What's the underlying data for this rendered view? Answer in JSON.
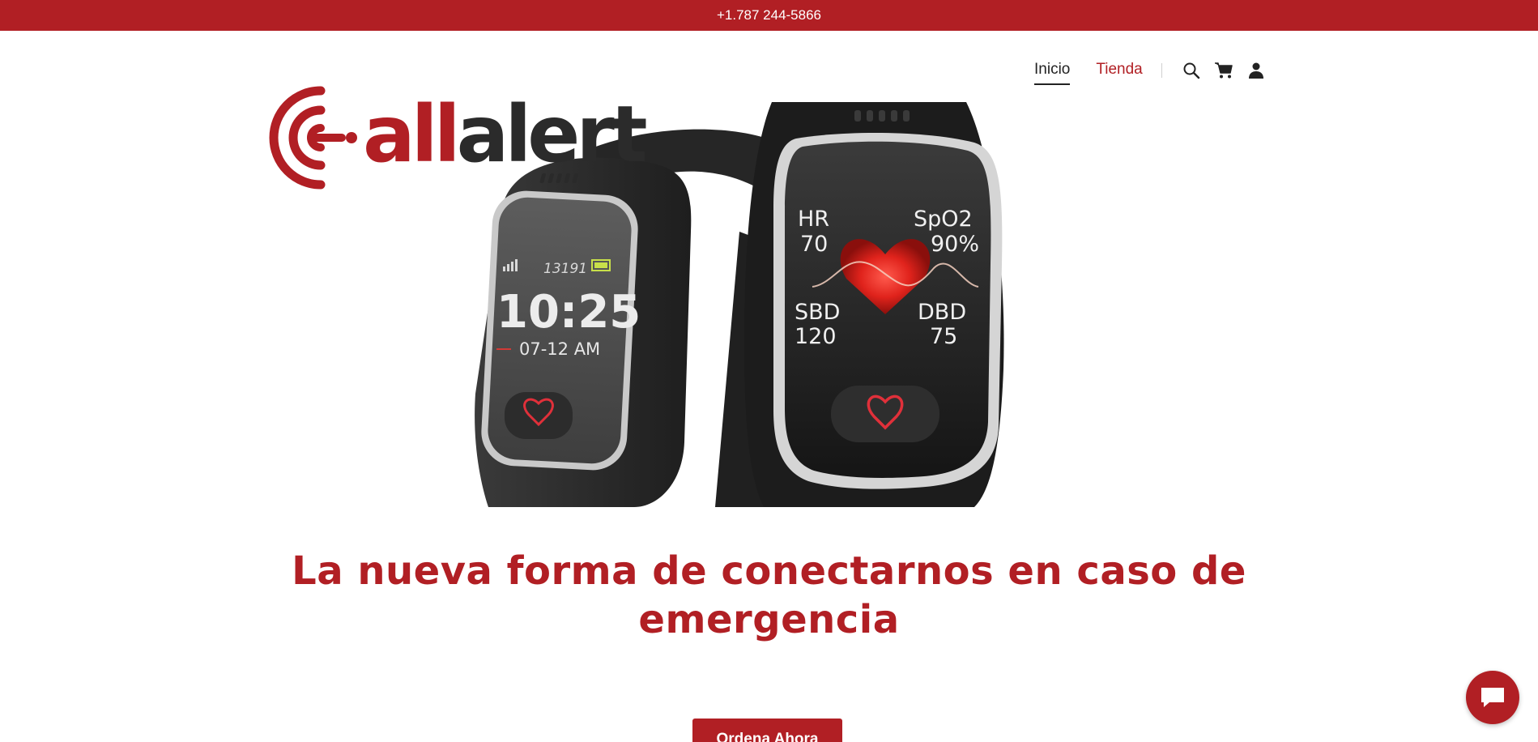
{
  "topbar": {
    "phone": "+1.787 244-5866"
  },
  "brand": {
    "name_part1": "all",
    "name_part2": "alert",
    "accent": "#b11f24",
    "dark": "#2b2b2b"
  },
  "nav": {
    "items": [
      {
        "label": "Inicio",
        "active": true
      },
      {
        "label": "Tienda",
        "active": false
      }
    ],
    "icons": [
      "search-icon",
      "cart-icon",
      "account-icon"
    ]
  },
  "hero": {
    "watch_left": {
      "time": "10:25",
      "date": "07-12 AM",
      "steps": "13191"
    },
    "watch_right": {
      "hr_label": "HR",
      "hr_value": "70",
      "spo2_label": "SpO2",
      "spo2_value": "90%",
      "sbd_label": "SBD",
      "sbd_value": "120",
      "dbd_label": "DBD",
      "dbd_value": "75"
    }
  },
  "headline": {
    "line1": "La nueva forma de conectarnos en caso de",
    "line2": "emergencia"
  },
  "cta": {
    "label": "Ordena Ahora"
  },
  "chat": {
    "icon": "chat-bubble-icon"
  }
}
